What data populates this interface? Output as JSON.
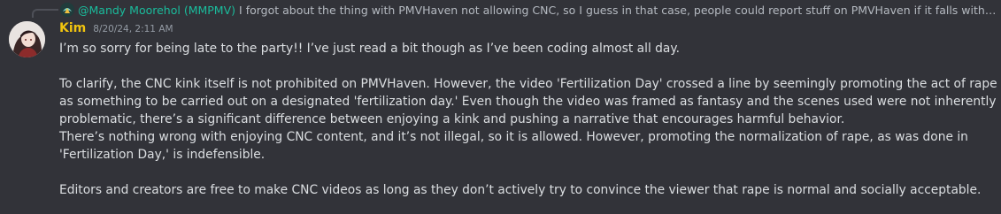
{
  "reply": {
    "author": "@Mandy Moorehol (MMPMV)",
    "text": "I forgot about the thing with PMVHaven not allowing CNC, so I guess in that case, people could report stuff on PMVHaven if it falls within that ..."
  },
  "message": {
    "author": "Kim",
    "timestamp": "8/20/24, 2:11 AM",
    "paragraphs": {
      "p1": "I’m so sorry for being late to the party!! I’ve just read a bit though as I’ve been coding almost all day.",
      "p2": "To clarify, the CNC kink itself is not prohibited on PMVHaven. However, the video 'Fertilization Day' crossed a line by seemingly promoting the act of rape as something to be carried out on a designated 'fertilization day.' Even though the video was framed as fantasy and the scenes used were not inherently problematic, there’s a significant difference between enjoying a kink and pushing a narrative that encourages harmful behavior.",
      "p3": "There’s nothing wrong with enjoying CNC content, and it’s not illegal, so it is allowed. However, promoting the normalization of rape, as was done in 'Fertilization Day,' is indefensible.",
      "p4": "Editors and creators are free to make CNC videos as long as they don’t actively try to convince the viewer that rape is normal and socially acceptable."
    }
  },
  "colors": {
    "background": "#323339",
    "reply_author": "#1abc9c",
    "author": "#f1c40f",
    "text": "#dbdee1",
    "muted": "#949ba4"
  }
}
